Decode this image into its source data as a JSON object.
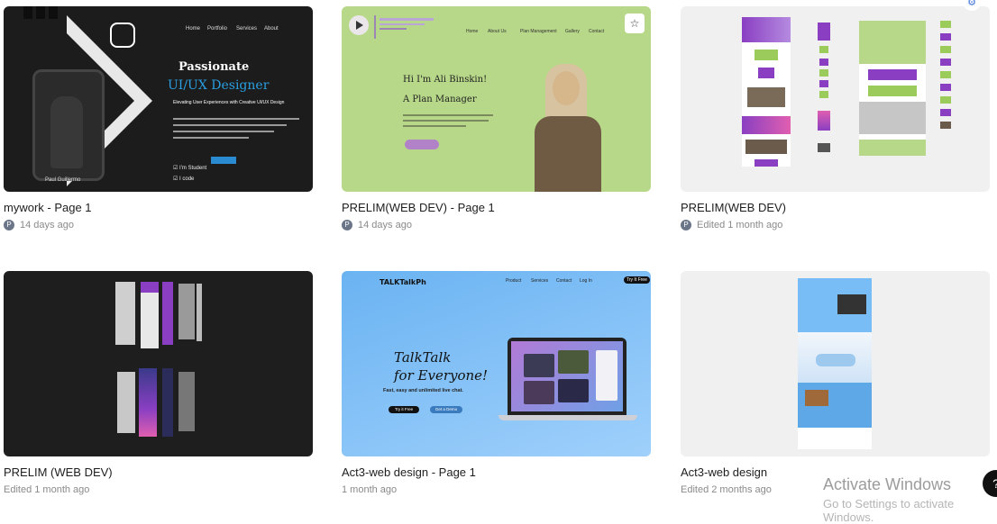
{
  "cards": [
    {
      "title": "mywork - Page 1",
      "avatar": "P",
      "meta": "14 days ago",
      "thumb": {
        "nav": [
          "Home",
          "Portfolio",
          "Services",
          "About"
        ],
        "heading1": "Passionate",
        "heading2": "UI/UX Designer",
        "subheading": "Elevating User Experiences with Creative UI/UX Design",
        "button": "Hire me",
        "checks": [
          "I'm Student",
          "I code"
        ],
        "name": "Paul Guillermo"
      }
    },
    {
      "title": "PRELIM(WEB DEV) - Page 1",
      "avatar": "P",
      "meta": "14 days ago",
      "thumb": {
        "brand": "LAVENDER",
        "nav": [
          "Home",
          "About Us",
          "Plan Management",
          "Gallery",
          "Contact"
        ],
        "greeting": "Hi I'm Ali Binskin!",
        "role": "A Plan Manager",
        "button": "Learn More",
        "star": "☆"
      }
    },
    {
      "title": "PRELIM(WEB DEV)",
      "avatar": "P",
      "meta": "Edited 1 month ago"
    },
    {
      "title": "PRELIM (WEB DEV)",
      "meta": "Edited 1 month ago"
    },
    {
      "title": "Act3-web design - Page 1",
      "meta": "1 month ago",
      "thumb": {
        "brand": "TALKTalkPh",
        "nav": [
          "Product",
          "Services",
          "Contact",
          "Log In"
        ],
        "try_button": "Try It Free",
        "heading_line1": "TalkTalk",
        "heading_line2": "for Everyone!",
        "subheading": "Fast, easy and unlimited live chat.",
        "button1": "Try it Free",
        "button2": "Get a Demo"
      }
    },
    {
      "title": "Act3-web design",
      "meta": "Edited 2 months ago"
    }
  ],
  "watermark": {
    "line1": "Activate Windows",
    "line2": "Go to Settings to activate Windows."
  },
  "colors": {
    "accent_blue": "#2a9ee0",
    "lavender_green": "#b7d889",
    "talktalk_blue": "#6ab3f2",
    "purple": "#8a3fc2"
  }
}
